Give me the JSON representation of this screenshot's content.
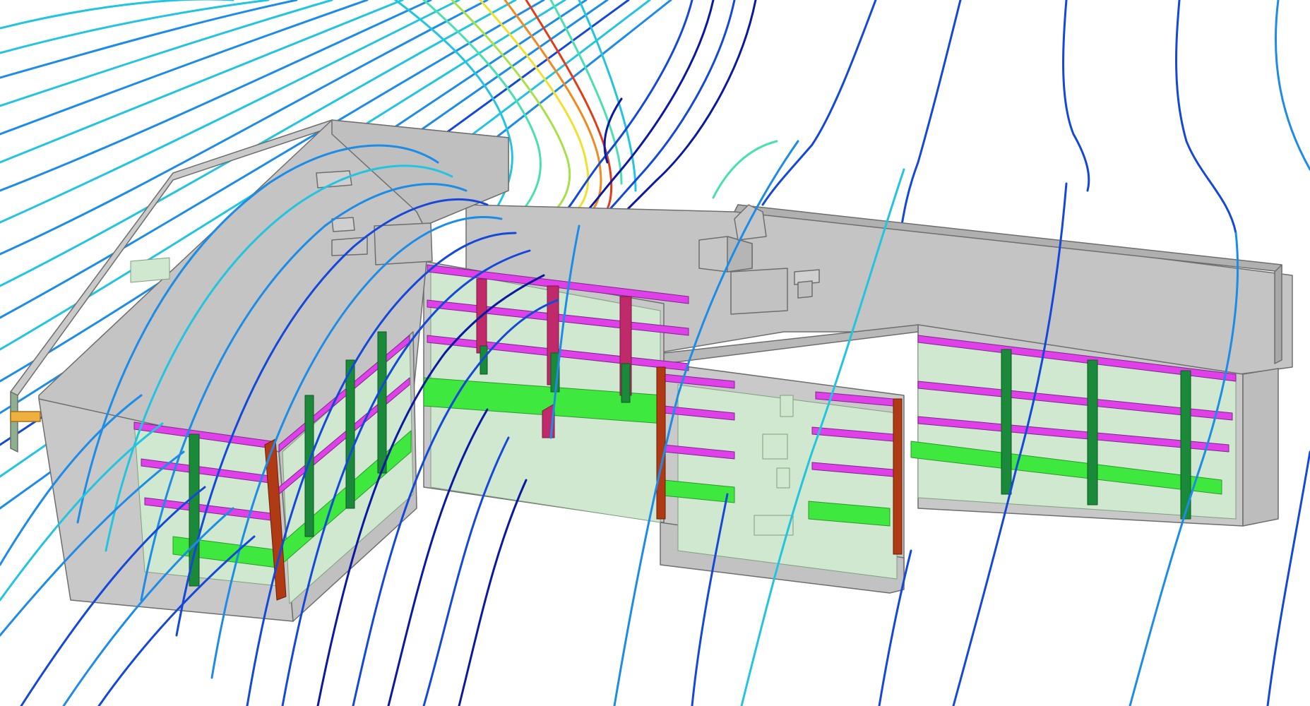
{
  "scene": {
    "background": "#ffffff",
    "palette": {
      "wall": "#c8c8c8",
      "wall_light": "#d6d6d6",
      "roof": "#c4c4c4",
      "roof_edge": "#a9a9a9",
      "outline": "#6e6e6e",
      "glazing": "#cfe8cf",
      "beam_magenta": "#e040e8",
      "beam_magenta_dark": "#b0289e",
      "beam_green": "#3ee83e",
      "column_green": "#1a8a3a",
      "column_brown": "#b03a14",
      "column_crimson": "#c02a6a",
      "accent_orange": "#f0b040"
    },
    "streamline_scale": [
      "#0a1aa0",
      "#1448d8",
      "#1c8ce6",
      "#22c4e0",
      "#48e0b0",
      "#a8e048",
      "#f0e030",
      "#f08a20",
      "#e03c18"
    ]
  }
}
